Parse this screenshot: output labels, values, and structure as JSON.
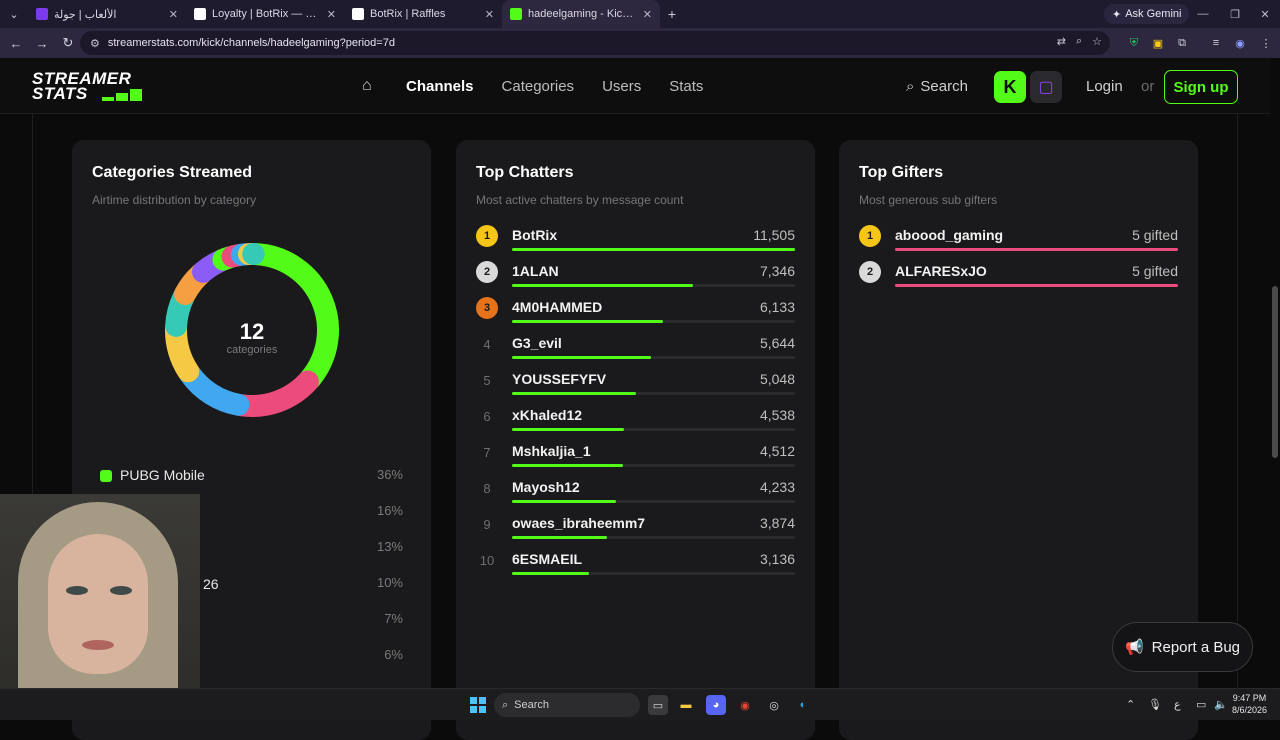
{
  "browser": {
    "tabs": [
      {
        "title": "الألعاب | جولة",
        "fav_color": "#7c3aed",
        "active": false
      },
      {
        "title": "Loyalty | BotRix — Cloud Stream",
        "fav_color": "#ffffff",
        "active": false
      },
      {
        "title": "BotRix | Raffles",
        "fav_color": "#ffffff",
        "active": false
      },
      {
        "title": "hadeelgaming - Kick | Strea",
        "fav_color": "#53fc18",
        "active": true
      }
    ],
    "ask_gemini": "Ask Gemini",
    "url": "streamerstats.com/kick/channels/hadeelgaming?period=7d"
  },
  "header": {
    "logo_line1": "STREAMER",
    "logo_line2": "STATS",
    "nav": [
      "Channels",
      "Categories",
      "Users",
      "Stats"
    ],
    "search_label": "Search",
    "login_label": "Login",
    "or_label": "or",
    "signup_label": "Sign up"
  },
  "categories_card": {
    "title": "Categories Streamed",
    "subtitle": "Airtime distribution by category",
    "center_number": "12",
    "center_label": "categories",
    "items": [
      {
        "name": "PUBG Mobile",
        "pct": "36%",
        "color": "#53fc18"
      },
      {
        "name": "",
        "pct": "16%",
        "color": "#ec4c7c"
      },
      {
        "name": "",
        "pct": "13%",
        "color": "#3fa8f0"
      },
      {
        "name": "",
        "pct": "10%",
        "color": "#f6c945"
      },
      {
        "name": "",
        "pct": "7%",
        "color": "#36c9b6"
      },
      {
        "name": "",
        "pct": "6%",
        "color": "#f59e42"
      }
    ],
    "partial_text": "26",
    "donut_segments": [
      {
        "value": 36,
        "color": "#53fc18"
      },
      {
        "value": 16,
        "color": "#ec4c7c"
      },
      {
        "value": 13,
        "color": "#3fa8f0"
      },
      {
        "value": 10,
        "color": "#f6c945"
      },
      {
        "value": 7,
        "color": "#36c9b6"
      },
      {
        "value": 6,
        "color": "#f59e42"
      },
      {
        "value": 5,
        "color": "#8b5cf6"
      },
      {
        "value": 2,
        "color": "#53fc18"
      },
      {
        "value": 2,
        "color": "#ec4c7c"
      },
      {
        "value": 1.5,
        "color": "#3fa8f0"
      },
      {
        "value": 1,
        "color": "#f6c945"
      },
      {
        "value": 0.5,
        "color": "#36c9b6"
      }
    ]
  },
  "chatters_card": {
    "title": "Top Chatters",
    "subtitle": "Most active chatters by message count",
    "rows": [
      {
        "rank": "1",
        "name": "BotRix",
        "value": "11,505",
        "fraction": 1.0
      },
      {
        "rank": "2",
        "name": "1ALAN",
        "value": "7,346",
        "fraction": 0.638
      },
      {
        "rank": "3",
        "name": "4M0HAMMED",
        "value": "6,133",
        "fraction": 0.533
      },
      {
        "rank": "4",
        "name": "G3_evil",
        "value": "5,644",
        "fraction": 0.491
      },
      {
        "rank": "5",
        "name": "YOUSSEFYFV",
        "value": "5,048",
        "fraction": 0.439
      },
      {
        "rank": "6",
        "name": "xKhaled12",
        "value": "4,538",
        "fraction": 0.394
      },
      {
        "rank": "7",
        "name": "Mshkaljia_1",
        "value": "4,512",
        "fraction": 0.392
      },
      {
        "rank": "8",
        "name": "Mayosh12",
        "value": "4,233",
        "fraction": 0.368
      },
      {
        "rank": "9",
        "name": "owaes_ibraheemm7",
        "value": "3,874",
        "fraction": 0.337
      },
      {
        "rank": "10",
        "name": "6ESMAEIL",
        "value": "3,136",
        "fraction": 0.273
      }
    ],
    "bar_color": "#53fc18"
  },
  "gifters_card": {
    "title": "Top Gifters",
    "subtitle": "Most generous sub gifters",
    "rows": [
      {
        "rank": "1",
        "name": "aboood_gaming",
        "value": "5 gifted",
        "fraction": 1.0
      },
      {
        "rank": "2",
        "name": "ALFARESxJO",
        "value": "5 gifted",
        "fraction": 1.0
      }
    ],
    "bar_color": "#ec4c7c"
  },
  "badge_colors": {
    "gold": "#f5c518",
    "silver": "#d9d9d9",
    "bronze": "#e6731a"
  },
  "report_bug_label": "Report a Bug",
  "taskbar": {
    "search_label": "Search",
    "lang": "ع",
    "time": "9:47 PM",
    "date": "8/6/2026"
  }
}
